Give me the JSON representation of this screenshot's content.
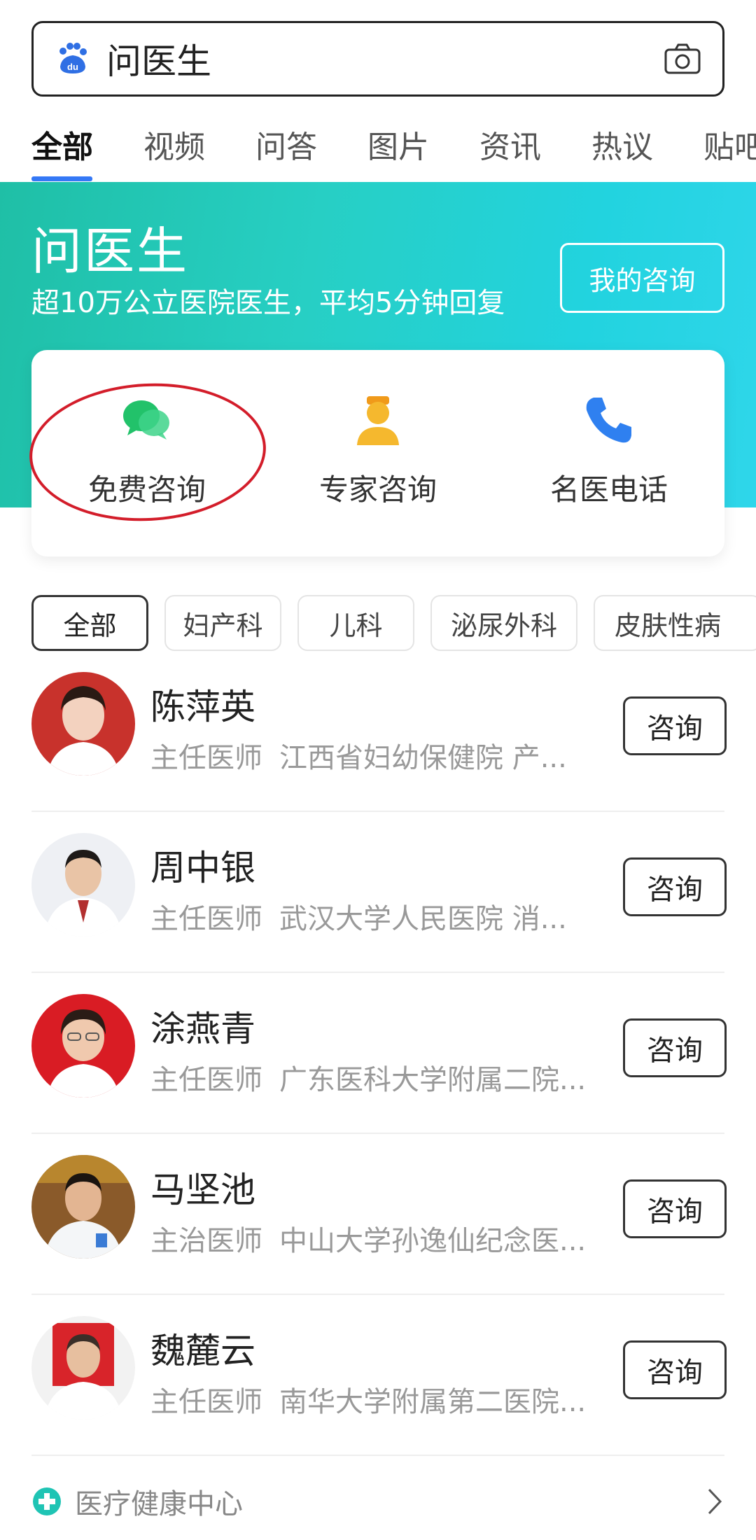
{
  "search": {
    "query": "问医生"
  },
  "tabs": [
    {
      "label": "全部",
      "active": true
    },
    {
      "label": "视频"
    },
    {
      "label": "问答"
    },
    {
      "label": "图片"
    },
    {
      "label": "资讯"
    },
    {
      "label": "热议"
    },
    {
      "label": "贴吧"
    }
  ],
  "hero": {
    "title": "问医生",
    "subtitle": "超10万公立医院医生，平均5分钟回复",
    "my_consult_label": "我的咨询"
  },
  "services": [
    {
      "label": "免费咨询",
      "icon": "chat-bubbles-icon",
      "color": "#22c26a"
    },
    {
      "label": "专家咨询",
      "icon": "doctor-icon",
      "color": "#f5b82e"
    },
    {
      "label": "名医电话",
      "icon": "phone-icon",
      "color": "#2f80f0"
    }
  ],
  "filters": [
    "全部",
    "妇产科",
    "儿科",
    "泌尿外科",
    "皮肤性病"
  ],
  "doctors": [
    {
      "name": "陈萍英",
      "title": "主任医师",
      "hospital": "江西省妇幼保健院  产...",
      "button": "咨询"
    },
    {
      "name": "周中银",
      "title": "主任医师",
      "hospital": "武汉大学人民医院  消...",
      "button": "咨询"
    },
    {
      "name": "涂燕青",
      "title": "主任医师",
      "hospital": "广东医科大学附属二院...",
      "button": "咨询"
    },
    {
      "name": "马坚池",
      "title": "主治医师",
      "hospital": "中山大学孙逸仙纪念医...",
      "button": "咨询"
    },
    {
      "name": "魏麓云",
      "title": "主任医师",
      "hospital": "南华大学附属第二医院...",
      "button": "咨询"
    }
  ],
  "footer": {
    "label": "医疗健康中心"
  },
  "colors": {
    "accent": "#3478f6",
    "hero_start": "#1fbfa6",
    "hero_end": "#2fd6ea",
    "highlight_ring": "#d31d2a"
  }
}
